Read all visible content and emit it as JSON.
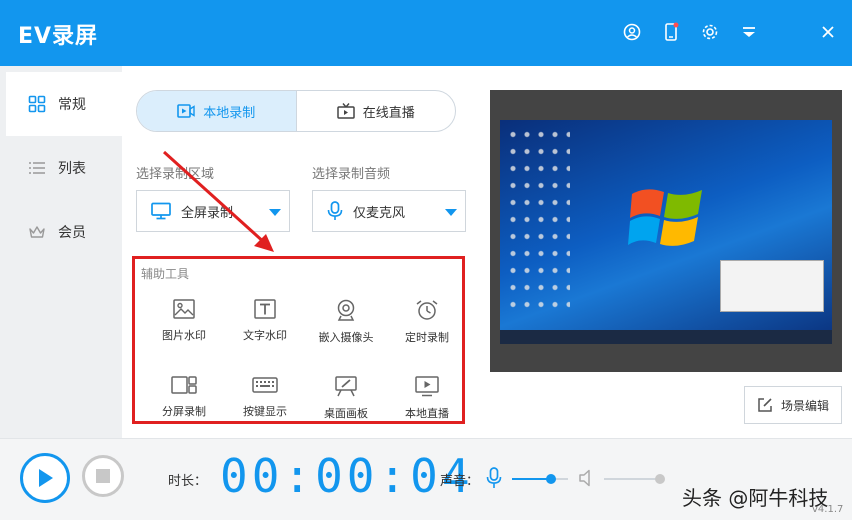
{
  "app": {
    "title": "EV录屏"
  },
  "titlebar_icons": [
    "user-icon",
    "phone-icon",
    "gear-icon",
    "menu-down-icon",
    "close-icon"
  ],
  "sidebar": {
    "items": [
      {
        "label": "常规",
        "icon": "grid-icon",
        "active": true
      },
      {
        "label": "列表",
        "icon": "list-icon",
        "active": false
      },
      {
        "label": "会员",
        "icon": "crown-icon",
        "active": false
      }
    ]
  },
  "mode_tabs": [
    {
      "label": "本地录制",
      "icon": "record-icon",
      "active": true
    },
    {
      "label": "在线直播",
      "icon": "tv-icon",
      "active": false
    }
  ],
  "record_area": {
    "label": "选择录制区域",
    "value": "全屏录制",
    "icon": "monitor-icon"
  },
  "record_audio": {
    "label": "选择录制音频",
    "value": "仅麦克风",
    "icon": "mic-icon"
  },
  "tools": {
    "title": "辅助工具",
    "items": [
      {
        "label": "图片水印",
        "icon": "image-icon"
      },
      {
        "label": "文字水印",
        "icon": "text-icon"
      },
      {
        "label": "嵌入摄像头",
        "icon": "webcam-icon"
      },
      {
        "label": "定时录制",
        "icon": "alarm-icon"
      },
      {
        "label": "分屏录制",
        "icon": "split-screen-icon"
      },
      {
        "label": "按键显示",
        "icon": "keyboard-icon"
      },
      {
        "label": "桌面画板",
        "icon": "easel-icon"
      },
      {
        "label": "本地直播",
        "icon": "play-screen-icon"
      }
    ]
  },
  "scene_button": {
    "label": "场景编辑",
    "icon": "edit-icon"
  },
  "bottom": {
    "duration_label": "时长：",
    "timer": "00:00:04",
    "volume_label": "声音：",
    "mic_level": 0.7,
    "speaker_level": 1.0
  },
  "watermark": "头条 @阿牛科技",
  "version": "v4.1.7",
  "colors": {
    "accent": "#1296ee",
    "highlight_border": "#e02020",
    "arrow": "#e02020"
  }
}
